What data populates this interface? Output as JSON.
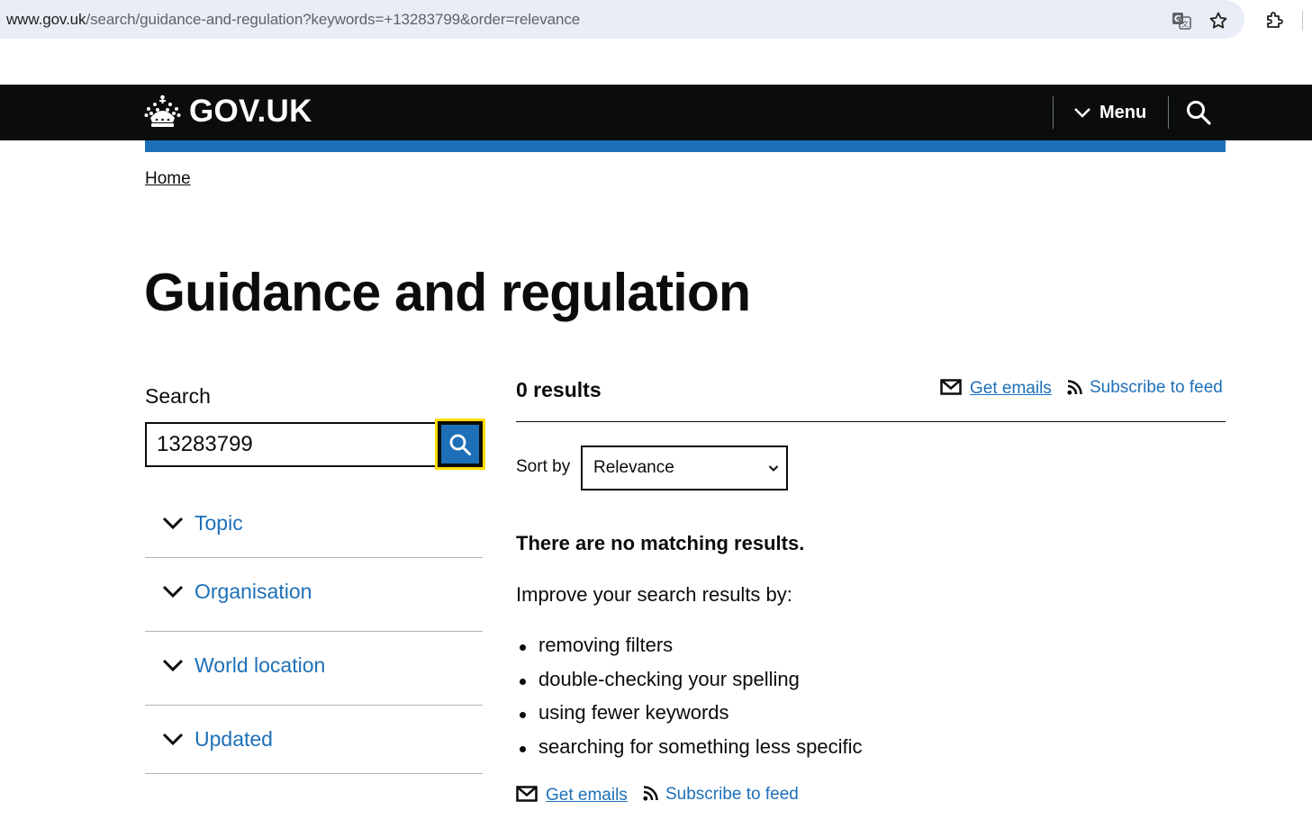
{
  "browser": {
    "url_host": "www.gov.uk",
    "url_path": "/search/guidance-and-regulation?keywords=+13283799&order=relevance"
  },
  "header": {
    "logo_text": "GOV.UK",
    "menu_label": "Menu"
  },
  "breadcrumb": {
    "home": "Home"
  },
  "page": {
    "title": "Guidance and regulation"
  },
  "search": {
    "label": "Search",
    "value": "13283799"
  },
  "facets": [
    {
      "label": "Topic"
    },
    {
      "label": "Organisation"
    },
    {
      "label": "World location"
    },
    {
      "label": "Updated"
    }
  ],
  "results": {
    "count_text": "0 results",
    "get_emails": "Get emails",
    "subscribe_feed": "Subscribe to feed",
    "sort_label": "Sort by",
    "sort_value": "Relevance",
    "no_match": "There are no matching results.",
    "improve": "Improve your search results by:",
    "tips": [
      "removing filters",
      "double-checking your spelling",
      "using fewer keywords",
      "searching for something less specific"
    ]
  },
  "colors": {
    "link": "#1d70b8",
    "header_bg": "#0b0c0c",
    "focus": "#ffdd00"
  }
}
